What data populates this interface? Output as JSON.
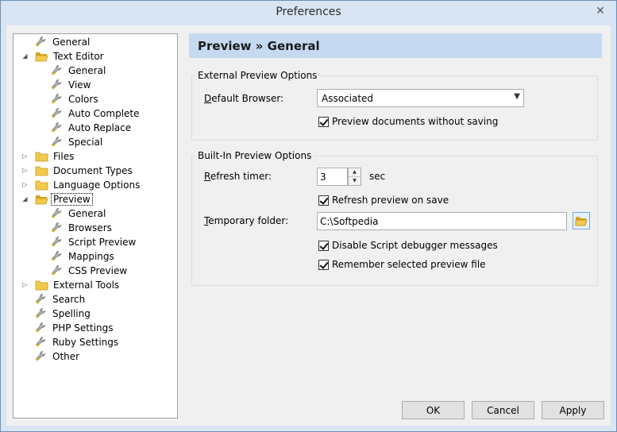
{
  "window": {
    "title": "Preferences",
    "close_glyph": "✕"
  },
  "tree": {
    "items": [
      {
        "label": "General",
        "icon": "wrench-icon",
        "level": 1
      },
      {
        "label": "Text Editor",
        "icon": "folder-open-icon",
        "level": 1,
        "expander": "expanded"
      },
      {
        "label": "General",
        "icon": "wrench-icon",
        "level": 2
      },
      {
        "label": "View",
        "icon": "wrench-icon",
        "level": 2
      },
      {
        "label": "Colors",
        "icon": "wrench-icon",
        "level": 2
      },
      {
        "label": "Auto Complete",
        "icon": "wrench-icon",
        "level": 2
      },
      {
        "label": "Auto Replace",
        "icon": "wrench-icon",
        "level": 2
      },
      {
        "label": "Special",
        "icon": "wrench-icon",
        "level": 2
      },
      {
        "label": "Files",
        "icon": "folder-icon",
        "level": 1,
        "expander": "collapsed"
      },
      {
        "label": "Document Types",
        "icon": "folder-icon",
        "level": 1,
        "expander": "collapsed"
      },
      {
        "label": "Language Options",
        "icon": "folder-icon",
        "level": 1,
        "expander": "collapsed"
      },
      {
        "label": "Preview",
        "icon": "folder-open-icon",
        "level": 1,
        "expander": "expanded",
        "selected": true
      },
      {
        "label": "General",
        "icon": "wrench-icon",
        "level": 2
      },
      {
        "label": "Browsers",
        "icon": "wrench-icon",
        "level": 2
      },
      {
        "label": "Script Preview",
        "icon": "wrench-icon",
        "level": 2
      },
      {
        "label": "Mappings",
        "icon": "wrench-icon",
        "level": 2
      },
      {
        "label": "CSS Preview",
        "icon": "wrench-icon",
        "level": 2
      },
      {
        "label": "External Tools",
        "icon": "folder-icon",
        "level": 1,
        "expander": "collapsed"
      },
      {
        "label": "Search",
        "icon": "wrench-icon",
        "level": 1
      },
      {
        "label": "Spelling",
        "icon": "wrench-icon",
        "level": 1
      },
      {
        "label": "PHP Settings",
        "icon": "wrench-icon",
        "level": 1
      },
      {
        "label": "Ruby Settings",
        "icon": "wrench-icon",
        "level": 1
      },
      {
        "label": "Other",
        "icon": "wrench-icon",
        "level": 1
      }
    ]
  },
  "panel": {
    "header": "Preview » General",
    "external": {
      "title": "External Preview Options",
      "default_browser_label": "Default Browser:",
      "default_browser_value": "Associated",
      "preview_without_saving": "Preview documents without saving"
    },
    "builtin": {
      "title": "Built-In Preview Options",
      "refresh_timer_label": "Refresh timer:",
      "refresh_timer_value": "3",
      "refresh_timer_unit": "sec",
      "refresh_on_save": "Refresh preview on save",
      "temp_folder_label": "Temporary folder:",
      "temp_folder_value": "C:\\Softpedia",
      "disable_debugger": "Disable Script debugger messages",
      "remember_file": "Remember selected preview file"
    }
  },
  "buttons": {
    "ok": "OK",
    "cancel": "Cancel",
    "apply": "Apply"
  },
  "colors": {
    "header_bg": "#c5daf1",
    "titlebar_bg": "#d9e5f3",
    "folder": "#f2c94c"
  }
}
